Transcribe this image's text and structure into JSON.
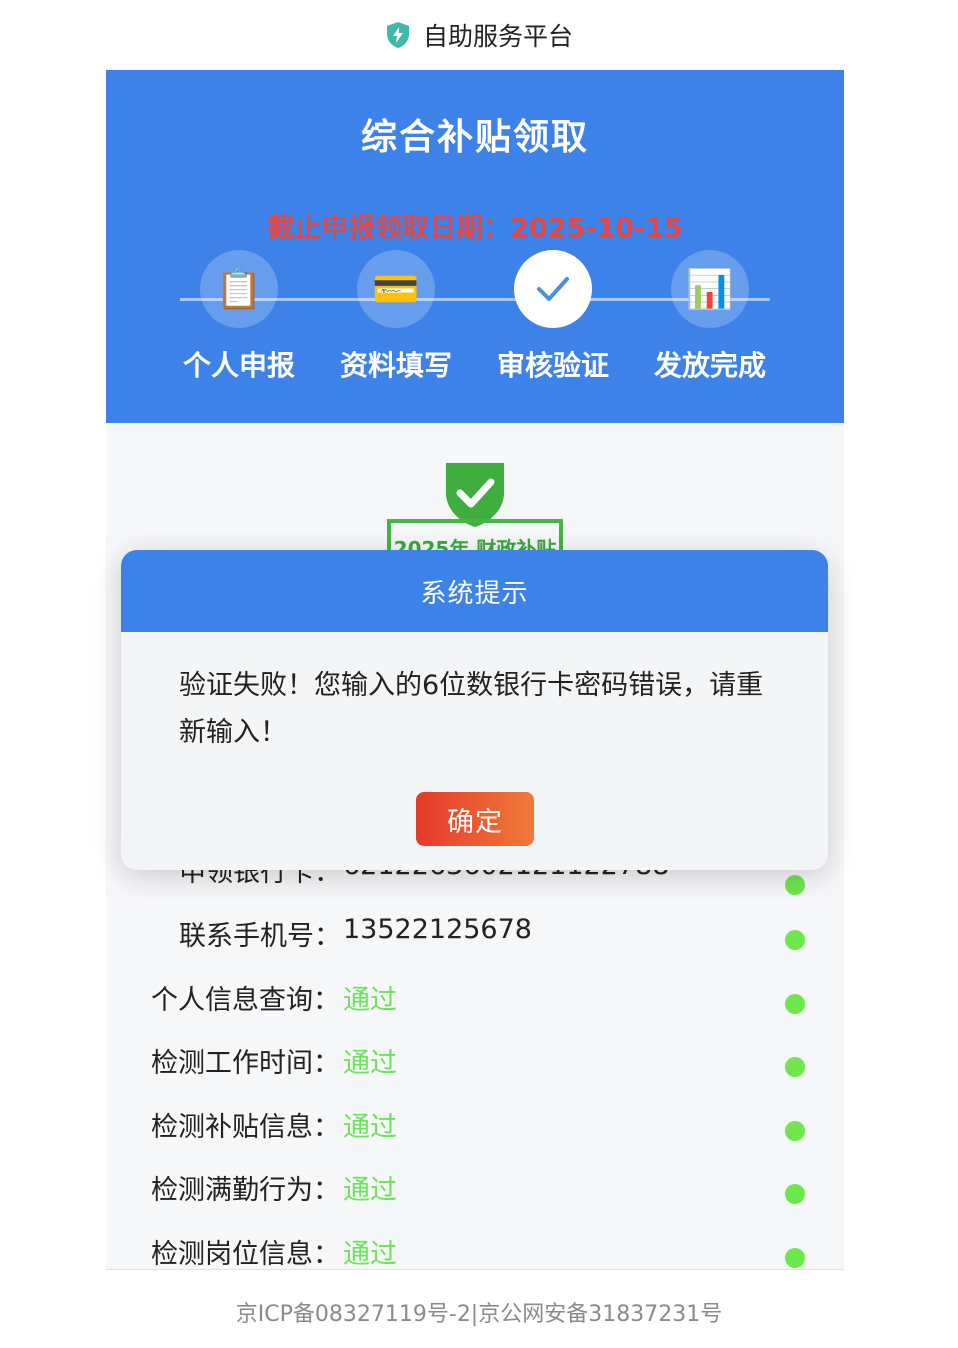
{
  "topbar": {
    "title": "自助服务平台",
    "icon": "shield-bolt-icon"
  },
  "hero": {
    "title": "综合补贴领取",
    "deadline_label": "截止申报领取日期：",
    "deadline_date": "2025-10-15",
    "steps": [
      {
        "label": "个人申报",
        "icon": "clipboard-icon"
      },
      {
        "label": "资料填写",
        "icon": "credit-card-icon"
      },
      {
        "label": "审核验证",
        "icon": "check-icon"
      },
      {
        "label": "发放完成",
        "icon": "bar-chart-icon"
      }
    ]
  },
  "badge": {
    "text": "2025年 财政补贴"
  },
  "details": {
    "bank_card_label": "申领银行卡：",
    "bank_card_value": "6212263602121122788",
    "phone_label": "联系手机号：",
    "phone_value": "13522125678",
    "checks": [
      {
        "label": "个人信息查询：",
        "status": "通过"
      },
      {
        "label": "检测工作时间：",
        "status": "通过"
      },
      {
        "label": "检测补贴信息：",
        "status": "通过"
      },
      {
        "label": "检测满勤行为：",
        "status": "通过"
      },
      {
        "label": "检测岗位信息：",
        "status": "通过"
      }
    ]
  },
  "dialog": {
    "title": "系统提示",
    "message": "验证失败！您输入的6位数银行卡密码错误，请重新输入！",
    "confirm_label": "确定"
  },
  "footer": {
    "text": "京ICP备08327119号-2|京公网安备31837231号"
  },
  "colors": {
    "primary": "#3d82e8",
    "deadline": "#e04848",
    "pass": "#6be356",
    "button_start": "#e53a2a",
    "button_end": "#f07a3a"
  }
}
